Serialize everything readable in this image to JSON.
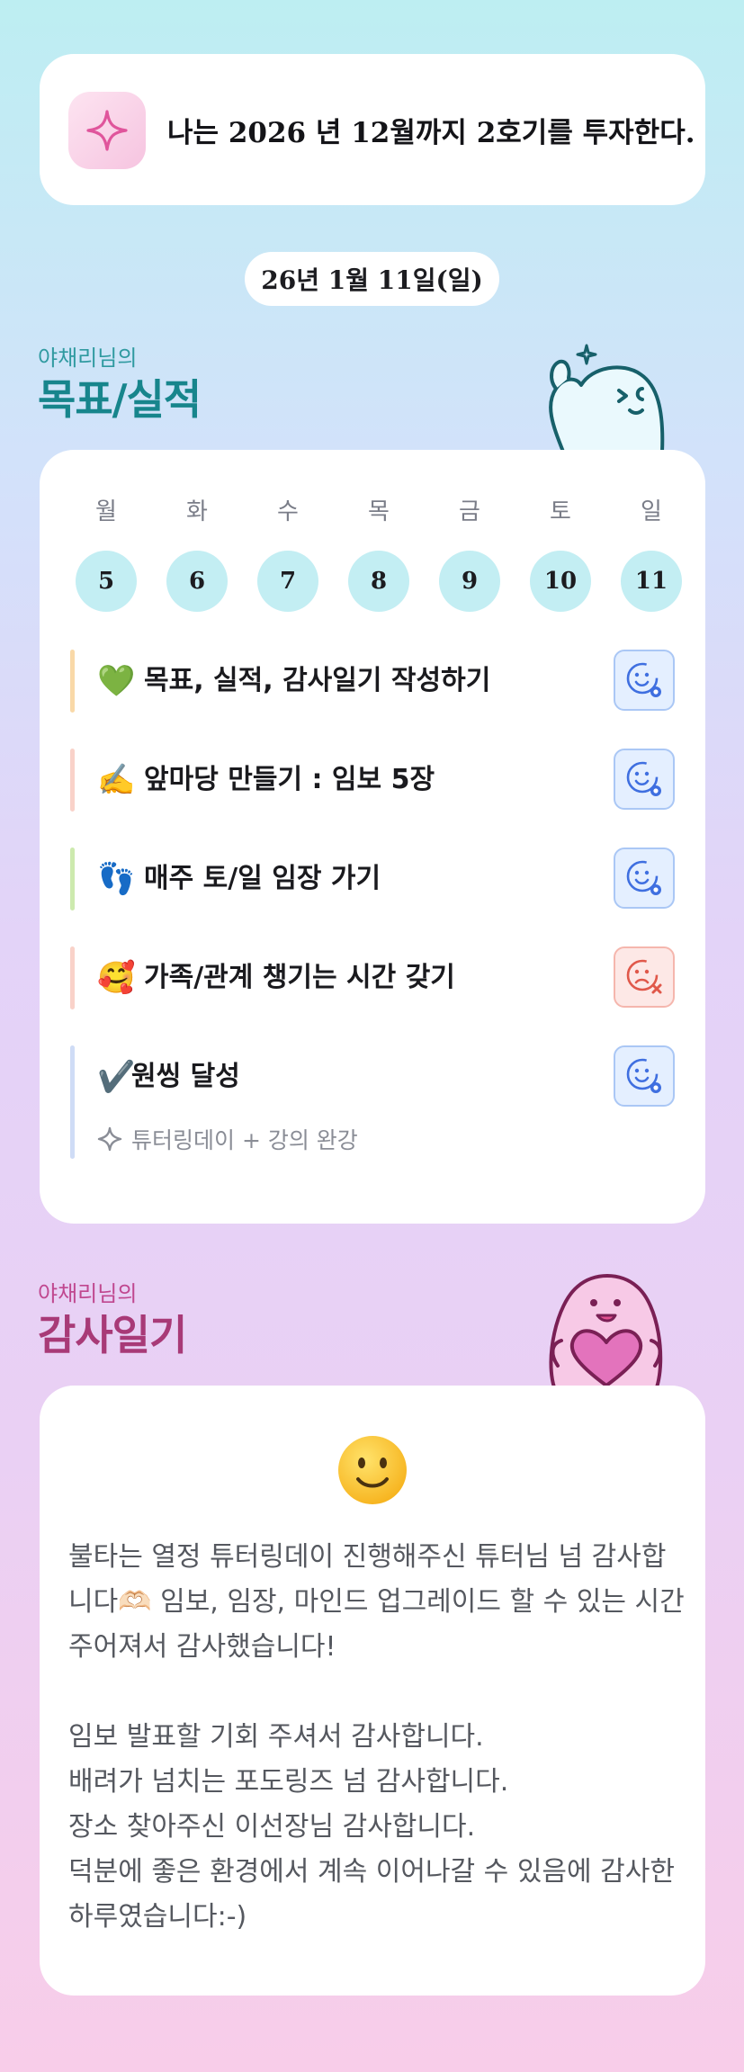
{
  "banner": {
    "icon": "sparkle-icon",
    "text": "나는 2026 년 12월까지 2호기를 투자한다."
  },
  "date": "26년 1월 11일(일)",
  "goals_section": {
    "subtitle": "야채리님의",
    "title": "목표/실적"
  },
  "week": [
    {
      "day": "월",
      "date": "5"
    },
    {
      "day": "화",
      "date": "6"
    },
    {
      "day": "수",
      "date": "7"
    },
    {
      "day": "목",
      "date": "8"
    },
    {
      "day": "금",
      "date": "9"
    },
    {
      "day": "토",
      "date": "10"
    },
    {
      "day": "일",
      "date": "11"
    }
  ],
  "goals": [
    {
      "emoji": "💚",
      "label": "목표, 실적, 감사일기 작성하기",
      "status": "done",
      "bar_color": "#f9d9a8"
    },
    {
      "emoji": "✍️",
      "label": "앞마당 만들기 : 임보 5장",
      "status": "done",
      "bar_color": "#f9d2c9"
    },
    {
      "emoji": "👣",
      "label": "매주 토/일 임장 가기",
      "status": "done",
      "bar_color": "#cdeaae"
    },
    {
      "emoji": "🥰",
      "label": "가족/관계 챙기는 시간 갖기",
      "status": "missed",
      "bar_color": "#f9d2c9"
    },
    {
      "emoji": "✔️",
      "label": "원씽 달성",
      "status": "done",
      "bar_color": "#cfdcf6"
    }
  ],
  "onething_detail": "튜터링데이 + 강의 완강",
  "gratitude_section": {
    "subtitle": "야채리님의",
    "title": "감사일기"
  },
  "gratitude": {
    "mood_icon": "slightly-smiling-face-icon",
    "text": "불타는 열정 튜터링데이 진행해주신 튜터님 넘 감사합니다🫶🏻 임보, 임장, 마인드 업그레이드 할 수 있는 시간 주어져서 감사했습니다!\n\n임보 발표할 기회 주셔서 감사합니다.\n배려가 넘치는 포도링즈 넘 감사합니다.\n장소 찾아주신 이선장님 감사합니다.\n덕분에 좋은 환경에서 계속 이어나갈 수 있음에 감사한 하루였습니다:-)"
  }
}
